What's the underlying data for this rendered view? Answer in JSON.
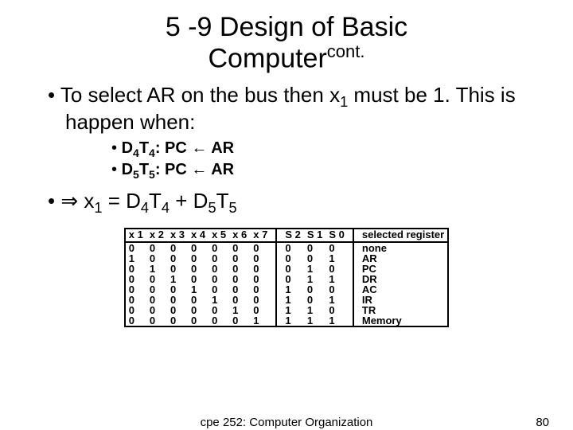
{
  "title_a": "5 -9 Design of Basic",
  "title_b": "Computer",
  "title_sup": "cont.",
  "p1_a": "To select AR on the bus then x",
  "p1_b": " must be 1. This is happen when:",
  "sub_a": "D",
  "sub_b": "T",
  "sub_c": ": PC ",
  "sub_d": " AR",
  "four": "4",
  "five": "5",
  "one": "1",
  "eq_a": " x",
  "eq_b": " = D",
  "eq_c": "T",
  "eq_d": " + D",
  "eq_e": "T",
  "implies": "⇒",
  "larrow": "←",
  "th": {
    "x1": "x 1",
    "x2": "x 2",
    "x3": "x 3",
    "x4": "x 4",
    "x5": "x 5",
    "x6": "x 6",
    "x7": "x 7",
    "s2": "S 2",
    "s1": "S 1",
    "s0": "S 0",
    "sel": "selected register"
  },
  "rows": [
    {
      "x": [
        "0",
        "0",
        "0",
        "0",
        "0",
        "0",
        "0"
      ],
      "s": [
        "0",
        "0",
        "0"
      ],
      "sel": "none"
    },
    {
      "x": [
        "1",
        "0",
        "0",
        "0",
        "0",
        "0",
        "0"
      ],
      "s": [
        "0",
        "0",
        "1"
      ],
      "sel": "AR"
    },
    {
      "x": [
        "0",
        "1",
        "0",
        "0",
        "0",
        "0",
        "0"
      ],
      "s": [
        "0",
        "1",
        "0"
      ],
      "sel": "PC"
    },
    {
      "x": [
        "0",
        "0",
        "1",
        "0",
        "0",
        "0",
        "0"
      ],
      "s": [
        "0",
        "1",
        "1"
      ],
      "sel": "DR"
    },
    {
      "x": [
        "0",
        "0",
        "0",
        "1",
        "0",
        "0",
        "0"
      ],
      "s": [
        "1",
        "0",
        "0"
      ],
      "sel": "AC"
    },
    {
      "x": [
        "0",
        "0",
        "0",
        "0",
        "1",
        "0",
        "0"
      ],
      "s": [
        "1",
        "0",
        "1"
      ],
      "sel": "IR"
    },
    {
      "x": [
        "0",
        "0",
        "0",
        "0",
        "0",
        "1",
        "0"
      ],
      "s": [
        "1",
        "1",
        "0"
      ],
      "sel": "TR"
    },
    {
      "x": [
        "0",
        "0",
        "0",
        "0",
        "0",
        "0",
        "1"
      ],
      "s": [
        "1",
        "1",
        "1"
      ],
      "sel": "Memory"
    }
  ],
  "footer_center": "cpe 252: Computer Organization",
  "footer_right": "80"
}
